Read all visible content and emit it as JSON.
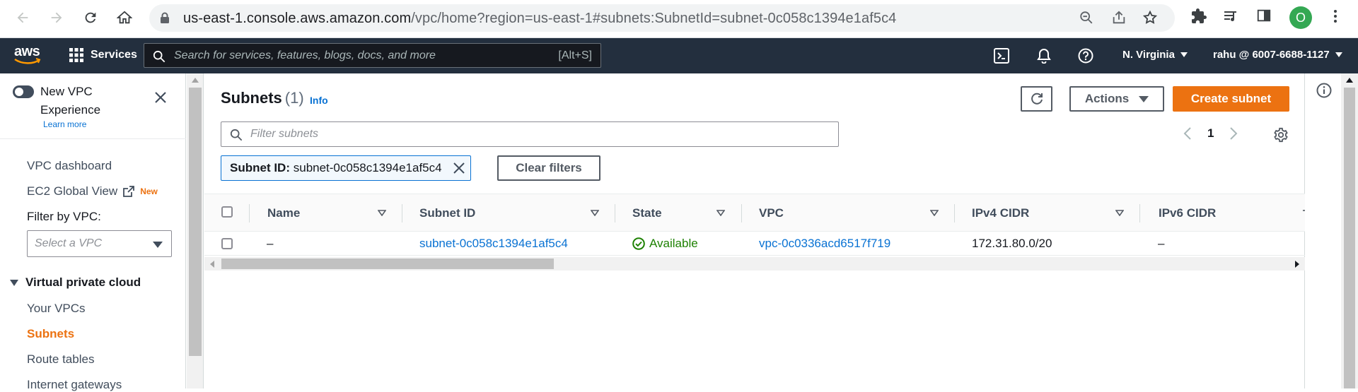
{
  "browser": {
    "url_host": "us-east-1.console.aws.amazon.com",
    "url_path": "/vpc/home?region=us-east-1#subnets:SubnetId=subnet-0c058c1394e1af5c4",
    "profile_initial": "O"
  },
  "aws_nav": {
    "logo_text": "aws",
    "services_label": "Services",
    "search_placeholder": "Search for services, features, blogs, docs, and more",
    "search_shortcut": "[Alt+S]",
    "region": "N. Virginia",
    "account": "rahu @ 6007-6688-1127"
  },
  "sidebar": {
    "experience_label": "New VPC Experience",
    "learn_more": "Learn more",
    "vpc_dashboard": "VPC dashboard",
    "ec2_global_view": "EC2 Global View",
    "new_badge": "New",
    "filter_label": "Filter by VPC:",
    "select_placeholder": "Select a VPC",
    "section_title": "Virtual private cloud",
    "items": [
      {
        "label": "Your VPCs",
        "active": false
      },
      {
        "label": "Subnets",
        "active": true
      },
      {
        "label": "Route tables",
        "active": false
      },
      {
        "label": "Internet gateways",
        "active": false
      }
    ]
  },
  "main": {
    "title": "Subnets",
    "count": "(1)",
    "info_link": "Info",
    "actions_label": "Actions",
    "create_label": "Create subnet",
    "filter_placeholder": "Filter subnets",
    "page_number": "1",
    "token_key": "Subnet ID:",
    "token_value": "subnet-0c058c1394e1af5c4",
    "clear_filters": "Clear filters",
    "columns": [
      "Name",
      "Subnet ID",
      "State",
      "VPC",
      "IPv4 CIDR",
      "IPv6 CIDR"
    ],
    "rows": [
      {
        "name": "–",
        "subnet_id": "subnet-0c058c1394e1af5c4",
        "state": "Available",
        "vpc": "vpc-0c0336acd6517f719",
        "ipv4_cidr": "172.31.80.0/20",
        "ipv6_cidr": "–"
      }
    ]
  },
  "colors": {
    "aws_nav_bg": "#232f3e",
    "accent_orange": "#ec7211",
    "link_blue": "#0972d3",
    "success_green": "#1d8102"
  }
}
